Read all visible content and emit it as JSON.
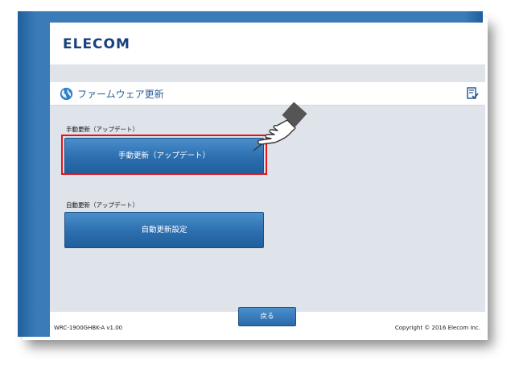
{
  "header": {
    "logo": "ELECOM"
  },
  "page": {
    "title": "ファームウェア更新"
  },
  "manual_update": {
    "label": "手動更新（アップデート）",
    "button": "手動更新（アップデート）"
  },
  "auto_update": {
    "label": "自動更新（アップデート）",
    "button": "自動更新設定"
  },
  "footer": {
    "back": "戻る",
    "version": "WRC-1900GHBK-A v1.00",
    "copyright": "Copyright © 2016 Elecom Inc."
  },
  "colors": {
    "accent": "#2c6eaf",
    "frame": "#2e6ea8",
    "highlight": "#e0141e",
    "content_bg": "#dfe3ea"
  },
  "icons": [
    "globe-icon",
    "document-check-icon",
    "pointing-hand-icon"
  ]
}
